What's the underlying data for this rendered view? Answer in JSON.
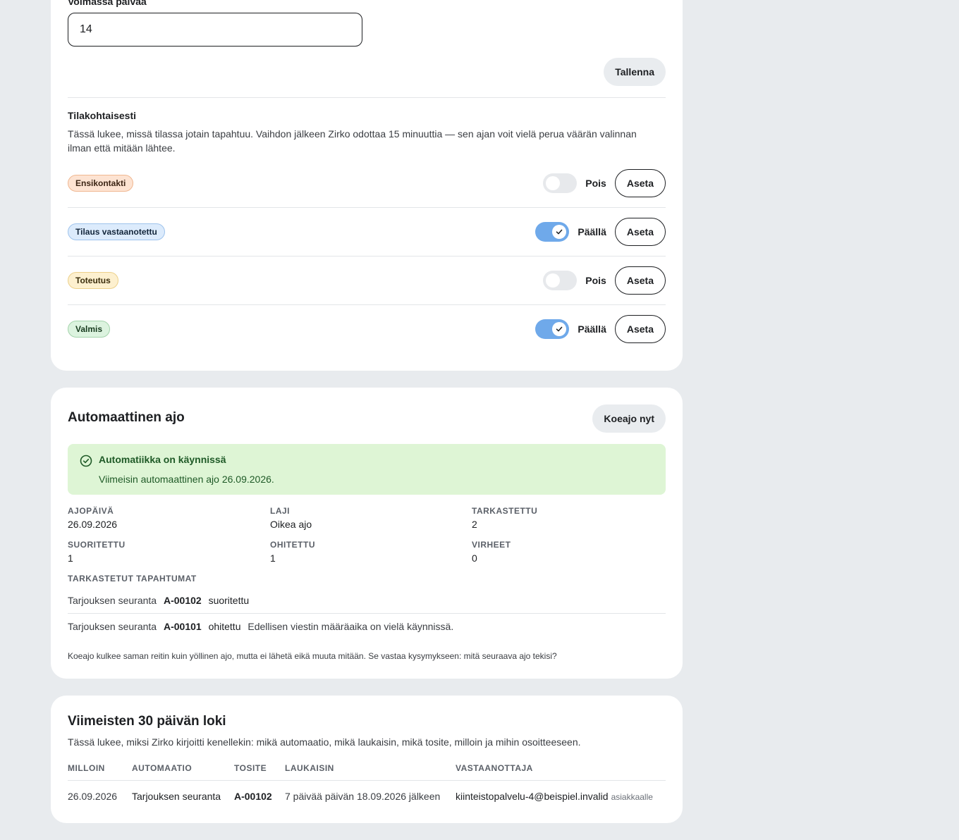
{
  "validity": {
    "label": "Voimassa päivää",
    "value": "14",
    "save_label": "Tallenna"
  },
  "per_state": {
    "title": "Tilakohtaisesti",
    "description": "Tässä lukee, missä tilassa jotain tapahtuu. Vaihdon jälkeen Zirko odottaa 15 minuuttia — sen ajan voit vielä perua väärän valinnan ilman että mitään lähtee.",
    "rows": [
      {
        "badge": "Ensikontakti",
        "toggle_label": "Pois",
        "enabled": false,
        "set_label": "Aseta"
      },
      {
        "badge": "Tilaus vastaanotettu",
        "toggle_label": "Päällä",
        "enabled": true,
        "set_label": "Aseta"
      },
      {
        "badge": "Toteutus",
        "toggle_label": "Pois",
        "enabled": false,
        "set_label": "Aseta"
      },
      {
        "badge": "Valmis",
        "toggle_label": "Päällä",
        "enabled": true,
        "set_label": "Aseta"
      }
    ]
  },
  "auto_run": {
    "title": "Automaattinen ajo",
    "trial_label": "Koeajo nyt",
    "alert": {
      "title": "Automatiikka on käynnissä",
      "text": "Viimeisin automaattinen ajo 26.09.2026."
    },
    "stats": [
      {
        "key": "AJOPÄIVÄ",
        "value": "26.09.2026"
      },
      {
        "key": "LAJI",
        "value": "Oikea ajo"
      },
      {
        "key": "TARKASTETTU",
        "value": "2"
      },
      {
        "key": "SUORITETTU",
        "value": "1"
      },
      {
        "key": "OHITETTU",
        "value": "1"
      },
      {
        "key": "VIRHEET",
        "value": "0"
      }
    ],
    "events_title": "TARKASTETUT TAPAHTUMAT",
    "events": [
      {
        "automation": "Tarjouksen seuranta",
        "code": "A-00102",
        "status": "suoritettu",
        "reason": ""
      },
      {
        "automation": "Tarjouksen seuranta",
        "code": "A-00101",
        "status": "ohitettu",
        "reason": "Edellisen viestin määräaika on vielä käynnissä."
      }
    ],
    "note": "Koeajo kulkee saman reitin kuin yöllinen ajo, mutta ei lähetä eikä muuta mitään. Se vastaa kysymykseen: mitä seuraava ajo tekisi?"
  },
  "log": {
    "title": "Viimeisten 30 päivän loki",
    "description": "Tässä lukee, miksi Zirko kirjoitti kenellekin: mikä automaatio, mikä laukaisin, mikä tosite, milloin ja mihin osoitteeseen.",
    "columns": [
      "MILLOIN",
      "AUTOMAATIO",
      "TOSITE",
      "LAUKAISIN",
      "VASTAANOTTAJA"
    ],
    "rows": [
      {
        "when": "26.09.2026",
        "automation": "Tarjouksen seuranta",
        "voucher": "A-00102",
        "trigger": "7 päivää päivän 18.09.2026 jälkeen",
        "recipient": "kiinteistopalvelu-4@beispiel.invalid",
        "recipient_note": "asiakkaalle"
      }
    ]
  },
  "colors": {
    "toggle_on": "#6fa9ea",
    "alert_bg": "#def5d5",
    "page_bg": "#e8ebee"
  }
}
